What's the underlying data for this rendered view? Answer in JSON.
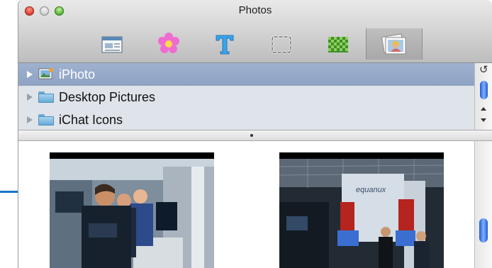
{
  "window": {
    "title": "Photos"
  },
  "toolbar": {
    "tools": [
      {
        "icon": "layout-icon"
      },
      {
        "icon": "flower-icon"
      },
      {
        "icon": "text-icon"
      },
      {
        "icon": "selection-icon"
      },
      {
        "icon": "texture-icon"
      },
      {
        "icon": "photos-icon",
        "selected": true
      }
    ]
  },
  "sources": {
    "items": [
      {
        "label": "iPhoto",
        "icon": "iphoto-icon",
        "selected": true
      },
      {
        "label": "Desktop Pictures",
        "icon": "folder-icon",
        "selected": false
      },
      {
        "label": "iChat Icons",
        "icon": "folder-icon",
        "selected": false
      }
    ]
  },
  "photos": {
    "items": [
      {
        "name": "photo-trade-show-people"
      },
      {
        "name": "photo-trade-show-booth"
      }
    ]
  },
  "colors": {
    "selection": "#8ea2c3",
    "scroll_thumb": "#2f6ae0",
    "callout_line": "#1a73c8"
  }
}
